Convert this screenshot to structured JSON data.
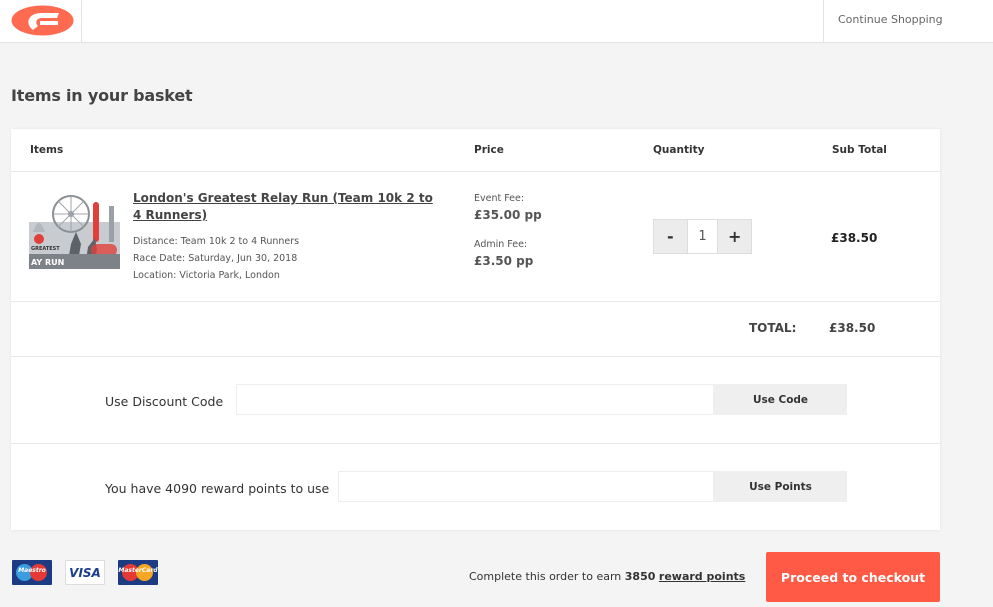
{
  "header": {
    "logo_alt": "brand-logo",
    "continue_label": "Continue Shopping"
  },
  "page": {
    "title": "Items in your basket"
  },
  "table": {
    "columns": [
      "Items",
      "Price",
      "Quantity",
      "Sub Total"
    ],
    "items": [
      {
        "title": "London's Greatest Relay Run (Team 10k 2 to 4 Runners)",
        "distance": "Distance: Team 10k 2 to 4 Runners",
        "race_date": "Race Date: Saturday, Jun 30, 2018",
        "location": "Location: Victoria Park, London",
        "event_fee_label": "Event Fee:",
        "event_fee": "£35.00 pp",
        "admin_fee_label": "Admin Fee:",
        "admin_fee": "£3.50 pp",
        "quantity": "1",
        "minus_label": "-",
        "plus_label": "+",
        "subtotal": "£38.50"
      }
    ],
    "total_label": "TOTAL:",
    "total_value": "£38.50"
  },
  "discount": {
    "label": "Use Discount Code",
    "value": "",
    "placeholder": "",
    "button": "Use Code"
  },
  "points": {
    "label": "You have 4090 reward points to use",
    "value": "",
    "placeholder": "",
    "button": "Use Points"
  },
  "footer": {
    "payment_cards": [
      "Maestro",
      "VISA",
      "MasterCard"
    ],
    "earn_prefix": "Complete this order to earn ",
    "earn_points": "3850",
    "earn_link": "reward points",
    "checkout_label": "Proceed to checkout"
  },
  "colors": {
    "accent": "#ff5a46",
    "background": "#f4f4f4"
  }
}
